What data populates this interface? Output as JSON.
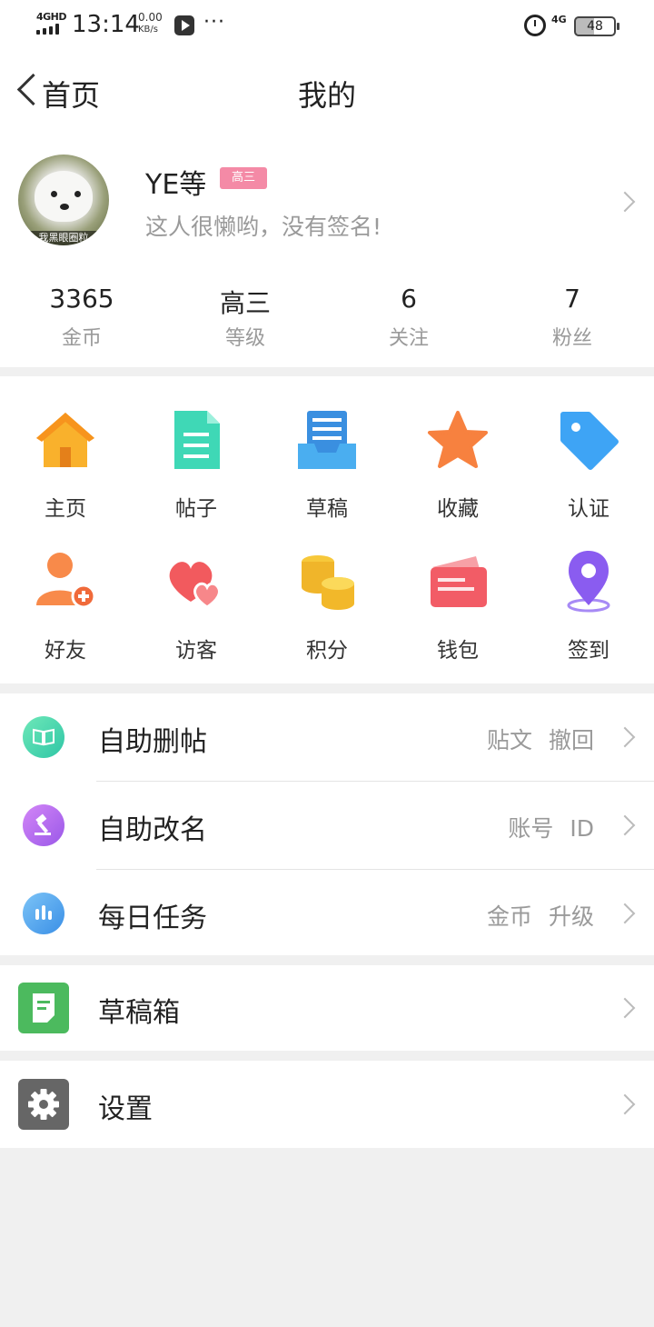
{
  "status_bar": {
    "network": "4GHD",
    "time": "13:14",
    "speed_value": "0.00",
    "speed_unit": "KB/s",
    "dots": "···",
    "signal_4g": "4G",
    "battery": "48"
  },
  "header": {
    "back_label": "首页",
    "title": "我的"
  },
  "profile": {
    "avatar_caption": "我黑眼圈粒",
    "username": "YE等",
    "level_badge": "高三",
    "signature": "这人很懒哟，没有签名!"
  },
  "stats": [
    {
      "value": "3365",
      "label": "金币"
    },
    {
      "value": "高三",
      "label": "等级"
    },
    {
      "value": "6",
      "label": "关注"
    },
    {
      "value": "7",
      "label": "粉丝"
    }
  ],
  "grid": [
    {
      "label": "主页",
      "icon": "home-icon",
      "color": "#f7a325"
    },
    {
      "label": "帖子",
      "icon": "document-icon",
      "color": "#3dd9b3"
    },
    {
      "label": "草稿",
      "icon": "draft-tray-icon",
      "color": "#3a9be8"
    },
    {
      "label": "收藏",
      "icon": "star-icon",
      "color": "#f77b3a"
    },
    {
      "label": "认证",
      "icon": "tag-icon",
      "color": "#3ea4f5"
    },
    {
      "label": "好友",
      "icon": "add-friend-icon",
      "color": "#f88a4a"
    },
    {
      "label": "访客",
      "icon": "hearts-icon",
      "color": "#f05a5e"
    },
    {
      "label": "积分",
      "icon": "coins-icon",
      "color": "#f5c232"
    },
    {
      "label": "钱包",
      "icon": "wallet-icon",
      "color": "#f05a66"
    },
    {
      "label": "签到",
      "icon": "location-pin-icon",
      "color": "#8a5cf0"
    }
  ],
  "menu": [
    {
      "title": "自助删帖",
      "extra": "贴文 撤回",
      "icon": "book-icon",
      "color": "#3ed6a4"
    },
    {
      "title": "自助改名",
      "extra": "账号 ID",
      "icon": "gavel-icon",
      "color": "#b66af0"
    },
    {
      "title": "每日任务",
      "extra": "金币 升级",
      "icon": "bar-chart-icon",
      "color": "#4aa3f0"
    },
    {
      "title": "草稿箱",
      "extra": "",
      "icon": "draft-note-icon",
      "color": "#4cba5e"
    },
    {
      "title": "设置",
      "extra": "",
      "icon": "gear-icon",
      "color": "#666666"
    }
  ]
}
